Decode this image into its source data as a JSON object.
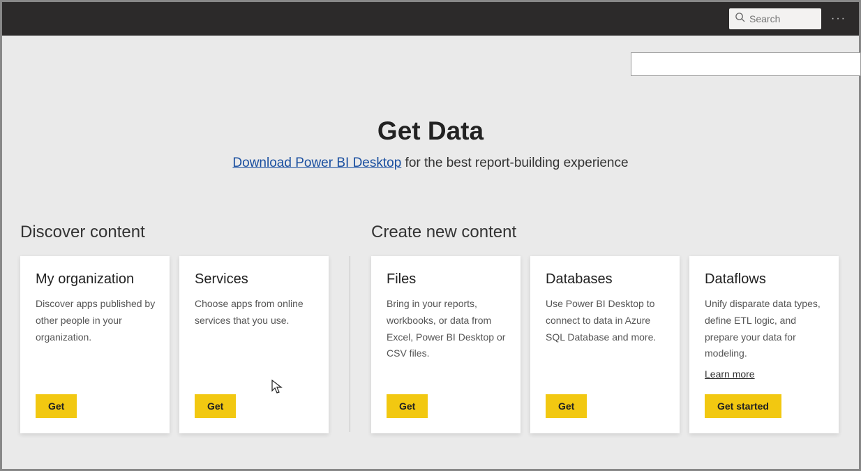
{
  "topbar": {
    "search_placeholder": "Search",
    "more_label": "···"
  },
  "hero": {
    "title": "Get Data",
    "download_link": "Download Power BI Desktop",
    "subtitle_rest": " for the best report-building experience"
  },
  "sections": {
    "discover": {
      "title": "Discover content",
      "cards": [
        {
          "title": "My organization",
          "desc": "Discover apps published by other people in your organization.",
          "button": "Get"
        },
        {
          "title": "Services",
          "desc": "Choose apps from online services that you use.",
          "button": "Get"
        }
      ]
    },
    "create": {
      "title": "Create new content",
      "cards": [
        {
          "title": "Files",
          "desc": "Bring in your reports, workbooks, or data from Excel, Power BI Desktop or CSV files.",
          "button": "Get"
        },
        {
          "title": "Databases",
          "desc": "Use Power BI Desktop to connect to data in Azure SQL Database and more.",
          "button": "Get"
        },
        {
          "title": "Dataflows",
          "desc": "Unify disparate data types, define ETL logic, and prepare your data for modeling.",
          "learn_more": "Learn more",
          "button": "Get started"
        }
      ]
    }
  }
}
